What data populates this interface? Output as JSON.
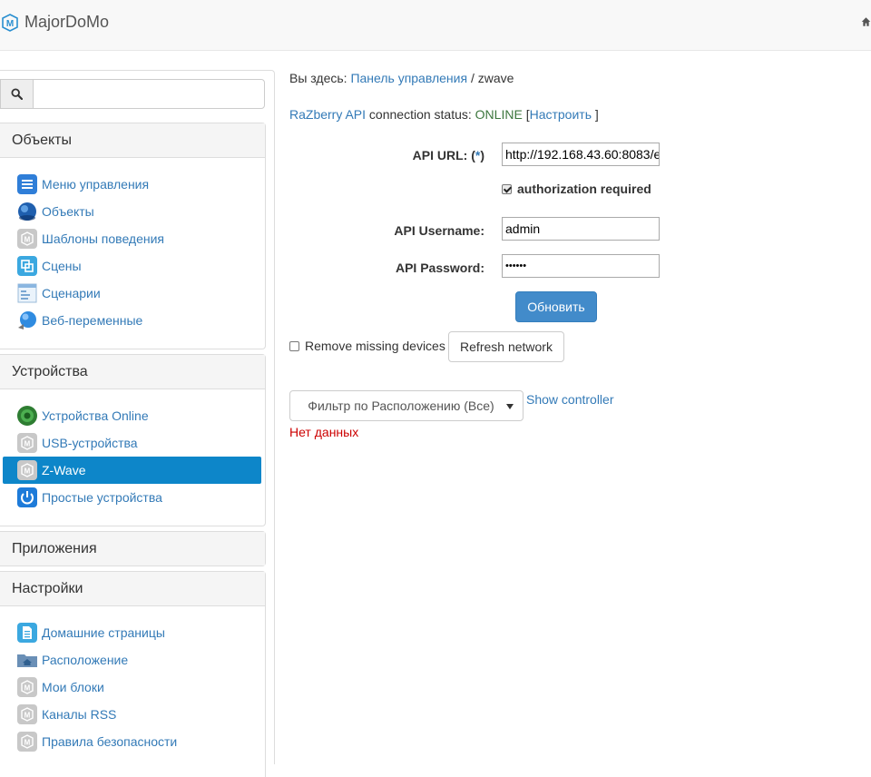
{
  "navbar": {
    "brand": "MajorDoMo"
  },
  "search": {
    "placeholder": ""
  },
  "sidebar": {
    "sections": [
      {
        "title": "Объекты",
        "items": [
          "Меню управления",
          "Объекты",
          "Шаблоны поведения",
          "Сцены",
          "Сценарии",
          "Веб-переменные"
        ]
      },
      {
        "title": "Устройства",
        "items": [
          "Устройства Online",
          "USB-устройства",
          "Z-Wave",
          "Простые устройства"
        ]
      },
      {
        "title": "Приложения"
      },
      {
        "title": "Настройки",
        "items": [
          "Домашние страницы",
          "Расположение",
          "Мои блоки",
          "Каналы RSS",
          "Правила безопасности"
        ]
      }
    ]
  },
  "breadcrumb": {
    "prefix": "Вы здесь:",
    "link": "Панель управления",
    "separator": "/",
    "current": "zwave"
  },
  "status": {
    "api_link": "RaZberry API",
    "text": "connection status:",
    "value": "ONLINE",
    "open": "[",
    "settings_link": "Настроить",
    "close": "]"
  },
  "form": {
    "api_url_label": "API URL:",
    "api_url_required_open": "(",
    "api_url_required_mark": "*",
    "api_url_required_close": ")",
    "api_url_value": "http://192.168.43.60:8083/e",
    "auth_label": "authorization required",
    "auth_checked": true,
    "username_label": "API Username:",
    "username_value": "admin",
    "password_label": "API Password:",
    "password_value": "••••••",
    "submit_label": "Обновить"
  },
  "network": {
    "remove_missing_label": "Remove missing devices",
    "refresh_label": "Refresh network"
  },
  "filter": {
    "selected": "Фильтр по Расположению (Все)",
    "show_controller": "Show controller"
  },
  "empty": {
    "message": "Нет данных"
  },
  "colors": {
    "link": "#337ab7",
    "online": "#3c763d",
    "active_menu": "#0d86c9",
    "primary_button": "#428bca",
    "error": "#cc0000"
  }
}
